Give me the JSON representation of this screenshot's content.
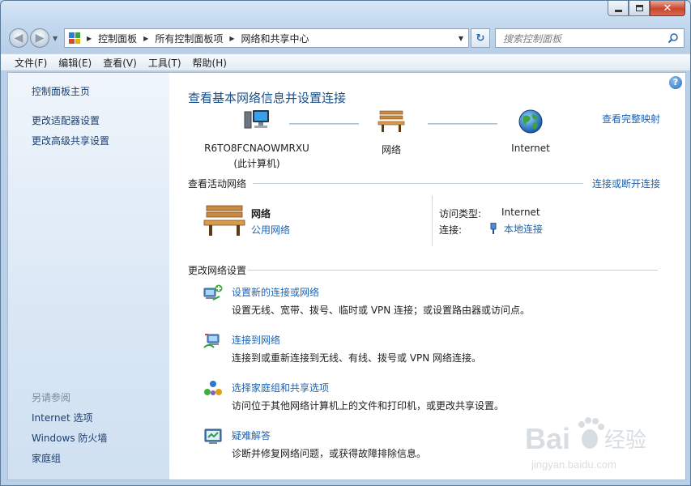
{
  "window": {
    "controls": {
      "minimize_icon": "minimize-icon",
      "maximize_icon": "maximize-icon",
      "close_icon": "close-icon"
    }
  },
  "address_bar": {
    "crumbs": [
      "控制面板",
      "所有控制面板项",
      "网络和共享中心"
    ],
    "search_placeholder": "搜索控制面板"
  },
  "menu": [
    "文件(F)",
    "编辑(E)",
    "查看(V)",
    "工具(T)",
    "帮助(H)"
  ],
  "sidebar": {
    "home": "控制面板主页",
    "links": [
      "更改适配器设置",
      "更改高级共享设置"
    ],
    "see_also_label": "另请参阅",
    "see_also": [
      "Internet 选项",
      "Windows 防火墙",
      "家庭组"
    ]
  },
  "main": {
    "title": "查看基本网络信息并设置连接",
    "view_full_map": "查看完整映射",
    "map_nodes": [
      {
        "name": "R6TO8FCNAOWMRXU",
        "sub": "(此计算机)",
        "icon": "computer-icon"
      },
      {
        "name": "网络",
        "sub": "",
        "icon": "bench-icon"
      },
      {
        "name": "Internet",
        "sub": "",
        "icon": "globe-icon"
      }
    ],
    "active_networks": {
      "title": "查看活动网络",
      "connect_link": "连接或断开连接",
      "network_name": "网络",
      "network_type": "公用网络",
      "access_type_label": "访问类型:",
      "access_type_value": "Internet",
      "connection_label": "连接:",
      "connection_value": "本地连接"
    },
    "change_settings": {
      "title": "更改网络设置",
      "tasks": [
        {
          "link": "设置新的连接或网络",
          "desc": "设置无线、宽带、拨号、临时或 VPN 连接；或设置路由器或访问点。",
          "icon": "new-connection-icon"
        },
        {
          "link": "连接到网络",
          "desc": "连接到或重新连接到无线、有线、拨号或 VPN 网络连接。",
          "icon": "connect-network-icon"
        },
        {
          "link": "选择家庭组和共享选项",
          "desc": "访问位于其他网络计算机上的文件和打印机，或更改共享设置。",
          "icon": "homegroup-icon"
        },
        {
          "link": "疑难解答",
          "desc": "诊断并修复网络问题，或获得故障排除信息。",
          "icon": "troubleshoot-icon"
        }
      ]
    }
  },
  "watermark": {
    "brand": "Bai",
    "brand_suffix": "经验",
    "url": "jingyan.baidu.com"
  },
  "colors": {
    "link": "#1d63b3",
    "title": "#1e4f87",
    "sidebar_link": "#1c3f6e"
  }
}
